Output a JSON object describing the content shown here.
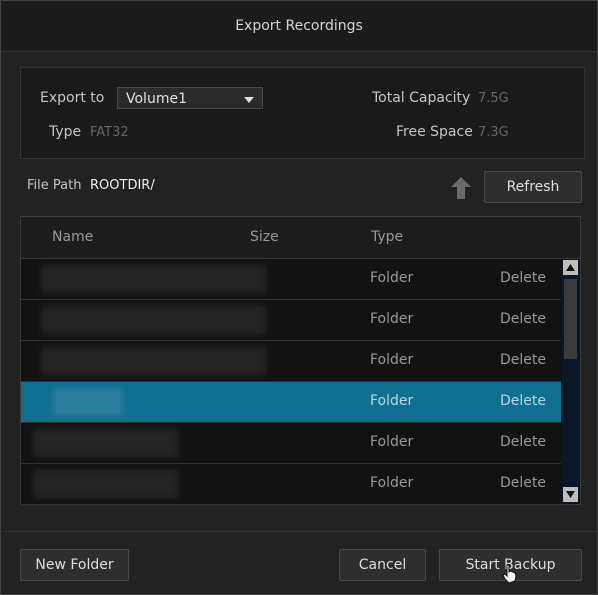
{
  "window": {
    "title": "Export Recordings"
  },
  "export": {
    "export_to_label": "Export to",
    "volume_selected": "Volume1",
    "type_label": "Type",
    "type_value": "FAT32",
    "capacity_label": "Total Capacity",
    "capacity_value": "7.5G",
    "free_label": "Free Space",
    "free_value": "7.3G"
  },
  "path": {
    "label": "File Path",
    "value": "ROOTDIR/",
    "refresh_label": "Refresh"
  },
  "table": {
    "columns": [
      "Name",
      "Size",
      "Type"
    ],
    "rows": [
      {
        "type": "Folder",
        "action": "Delete"
      },
      {
        "type": "Folder",
        "action": "Delete"
      },
      {
        "type": "Folder",
        "action": "Delete"
      },
      {
        "type": "Folder",
        "action": "Delete",
        "selected": true
      },
      {
        "type": "Folder",
        "action": "Delete"
      },
      {
        "type": "Folder",
        "action": "Delete"
      }
    ]
  },
  "footer": {
    "new_folder_label": "New Folder",
    "cancel_label": "Cancel",
    "start_backup_label": "Start Backup"
  },
  "colors": {
    "selected_row": "#0e6f90",
    "background": "#222222"
  }
}
